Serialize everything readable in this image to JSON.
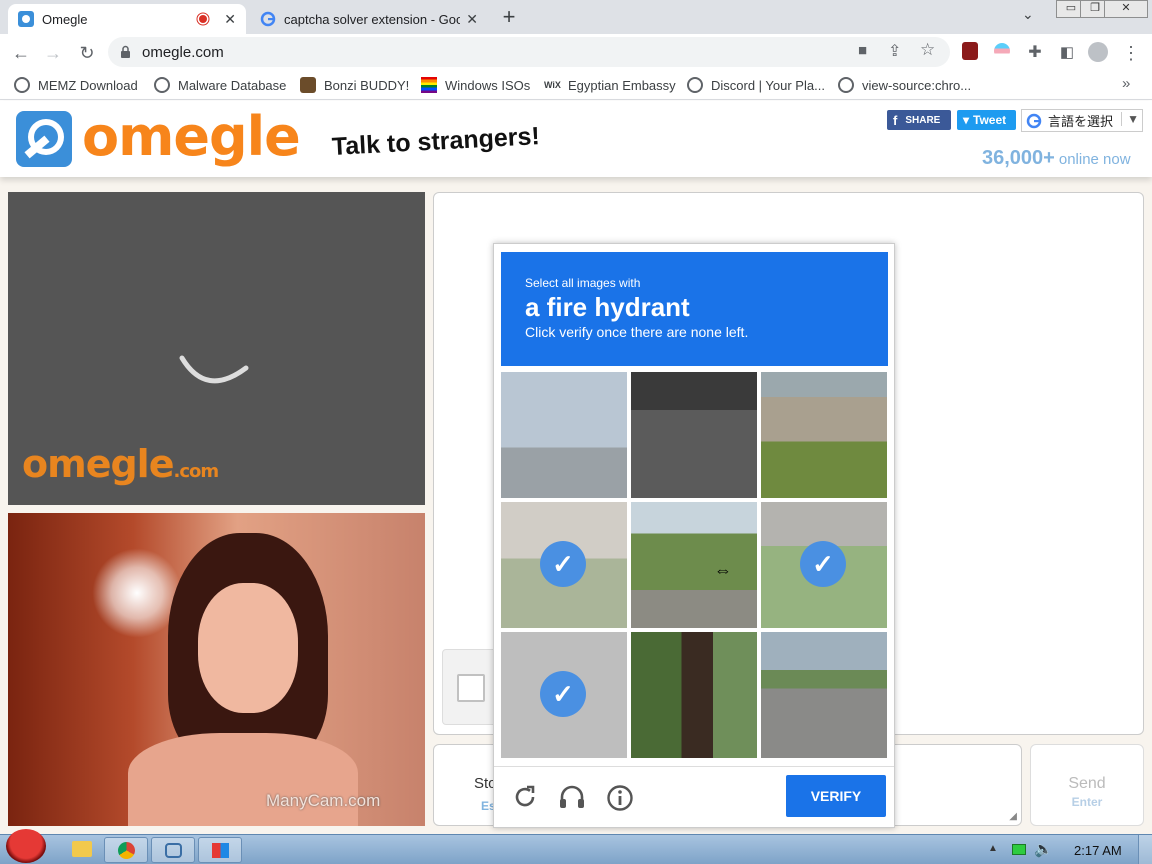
{
  "tabs": [
    {
      "title": "Omegle",
      "active": true,
      "recording": true
    },
    {
      "title": "captcha solver extension - Goo",
      "active": false
    }
  ],
  "new_tab_label": "+",
  "address_bar": {
    "url": "omegle.com"
  },
  "bookmarks": [
    {
      "label": "MEMZ Download",
      "icon": "globe-icon"
    },
    {
      "label": "Malware Database",
      "icon": "globe-icon"
    },
    {
      "label": "Bonzi BUDDY!",
      "icon": "bonzi-icon"
    },
    {
      "label": "Windows ISOs",
      "icon": "rainbow-flag-icon"
    },
    {
      "label": "Egyptian Embassy",
      "icon": "wix-icon"
    },
    {
      "label": "Discord | Your Pla...",
      "icon": "globe-icon"
    },
    {
      "label": "view-source:chro...",
      "icon": "globe-icon"
    }
  ],
  "bookmarks_overflow": "»",
  "omegle": {
    "logo": "omegle",
    "tagline": "Talk to strangers!",
    "share_label": "SHARE",
    "tweet_label": "Tweet",
    "translate_label": "言語を選択",
    "online_count": "36,000+",
    "online_label": "online now",
    "video_watermark": "omegle",
    "video_watermark_suffix": ".com",
    "cam_watermark": "ManyCam.com",
    "stop_label": "Sto",
    "stop_sub": "Es",
    "send_label": "Send",
    "send_sub": "Enter"
  },
  "captcha": {
    "prompt_small": "Select all images with",
    "prompt_target": "a fire hydrant",
    "prompt_sub": "Click verify once there are none left.",
    "tiles_selected": [
      false,
      false,
      false,
      true,
      false,
      true,
      true,
      false,
      false
    ],
    "verify_label": "VERIFY",
    "reload_icon": "reload-icon",
    "audio_icon": "headphones-icon",
    "info_icon": "info-icon"
  },
  "taskbar": {
    "clock": "2:17 AM"
  },
  "colors": {
    "omegle_orange": "#f7851b",
    "captcha_blue": "#1a73e8",
    "online_blue": "#80b3df"
  }
}
